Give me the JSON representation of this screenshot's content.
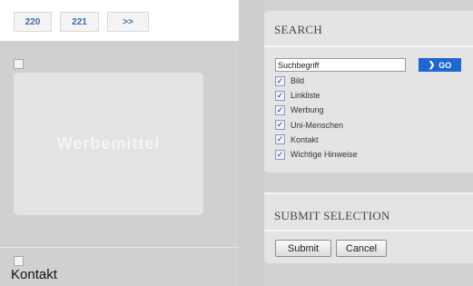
{
  "pagination": {
    "pages": [
      "220",
      "221"
    ],
    "next_label": ">>"
  },
  "ad": {
    "label": "Werbemittel"
  },
  "left_footer": {
    "label": "Kontakt"
  },
  "search": {
    "title": "SEARCH",
    "input_value": "Suchbegriff",
    "go_label": "GO",
    "filters": [
      {
        "label": "Bild",
        "checked": true
      },
      {
        "label": "Linkliste",
        "checked": true
      },
      {
        "label": "Werbung",
        "checked": true
      },
      {
        "label": "Uni-Menschen",
        "checked": true
      },
      {
        "label": "Kontakt",
        "checked": true
      },
      {
        "label": "Wichtige Hinweise",
        "checked": true
      }
    ]
  },
  "submit_selection": {
    "title": "SUBMIT SELECTION",
    "submit_label": "Submit",
    "cancel_label": "Cancel"
  },
  "colors": {
    "accent": "#1e67d0",
    "page_link": "#3b6ca3",
    "panel_bg": "#e4e4e4",
    "page_bg": "#d2d2d2"
  }
}
